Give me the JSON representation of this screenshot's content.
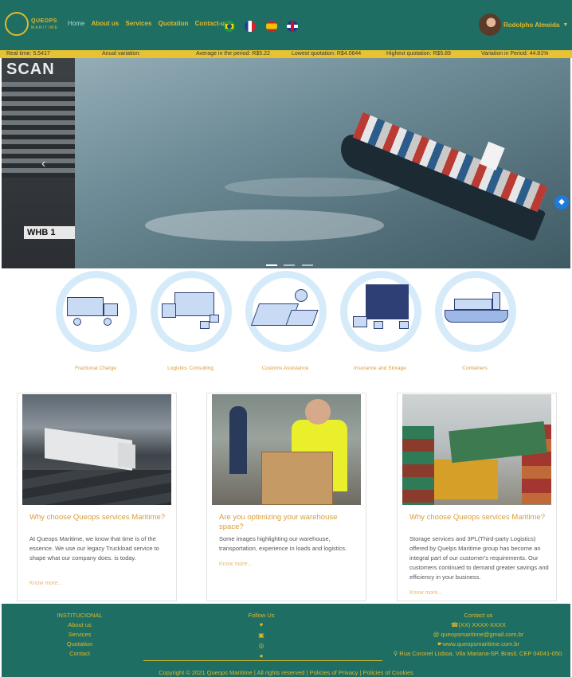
{
  "brand": {
    "name": "QUEOPS",
    "tagline": "MARITIME"
  },
  "nav": {
    "items": [
      "Home",
      "About us",
      "Services",
      "Quotation",
      "Contact-us"
    ],
    "languages": [
      "Portuguese (Brazil)",
      "French",
      "Spanish",
      "English (UK)"
    ]
  },
  "user": {
    "name": "Rodolpho Almeida"
  },
  "ticker": {
    "real_time": "Real time: 5.5417",
    "annual_variation": "Anual variation:",
    "average": "Average in the period: R$5.22",
    "lowest": "Lowest quotation: R$4.0644",
    "highest": "Highest quotation: R$5.89",
    "variation_period": "Variation in Period: 44.81%"
  },
  "hero": {
    "plate_text": "WHB 1",
    "truck_text": "SCAN",
    "slides": 3,
    "active_slide": 1
  },
  "services": [
    {
      "label": "Fractional Charge",
      "icon": "truck-forklift-icon"
    },
    {
      "label": "Logistics Consulting",
      "icon": "delivery-truck-icon"
    },
    {
      "label": "Customs Assistance",
      "icon": "documents-calculator-icon"
    },
    {
      "label": "Insurance and Storage",
      "icon": "warehouse-icon"
    },
    {
      "label": "Containers",
      "icon": "container-ship-icon"
    }
  ],
  "cards": [
    {
      "title": "Why choose Queops services Maritime?",
      "text": "At Queops Maritime, we know that time is of the essence. We use our legacy Truckload service to shape what our company does. is today.",
      "link": "Know more..."
    },
    {
      "title": "Are you optimizing your warehouse space?",
      "text": "Some images highlighting our warehouse, transportation, experience in loads and logistics.",
      "link": "Know more..."
    },
    {
      "title": "Why choose Queops services Maritime?",
      "text": "Storage services and 3PL(Third-party Logistics) offered by Quelps Maritime group has become an integral part of our customer's requirements. Our customers continued to demand greater savings and efficiency in your business.",
      "link": "Know more..."
    }
  ],
  "footer": {
    "institutional_title": "INSTITUCIONAL",
    "institutional_links": [
      "About us",
      "Services",
      "Quotation",
      "Contact"
    ],
    "follow_title": "Follow Us",
    "social_icons": [
      "twitter-icon",
      "linkedin-icon",
      "instagram-icon",
      "facebook-icon"
    ],
    "contact_title": "Contact us",
    "phone": "(XX) XXXX-XXXX",
    "email": "queopsmaritime@gmail.com.br",
    "website": "www.queopsmaritime.com.br",
    "address": "Rua Coronel Lisboa, Vila Mariana-SP, Brasil, CEP 04041-050.",
    "copyright": "Copyright © 2021 Queops Maritime | All rights reserved | Policies of Privacy | Policies of Cookies"
  },
  "colors": {
    "teal": "#1f6e64",
    "gold": "#e0b82a",
    "ticker": "#e7c233",
    "accent_text": "#d89d37"
  }
}
